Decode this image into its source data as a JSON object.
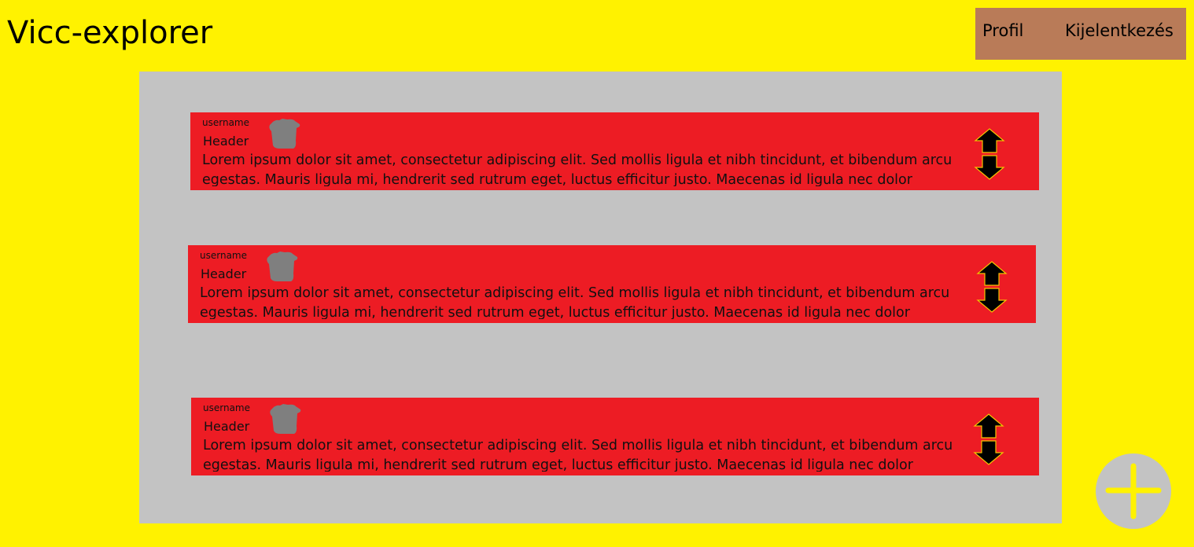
{
  "app": {
    "title": "Vicc-explorer"
  },
  "nav": {
    "profile_label": "Profil",
    "logout_label": "Kijelentkezés"
  },
  "jokes": [
    {
      "username": "username",
      "header": "Header",
      "text": "Lorem ipsum dolor sit amet, consectetur adipiscing elit. Sed mollis ligula et nibh tincidunt, et bibendum arcu egestas. Mauris ligula mi, hendrerit sed rutrum eget, luctus efficitur justo. Maecenas id ligula nec dolor viverra"
    },
    {
      "username": "username",
      "header": "Header",
      "text": "Lorem ipsum dolor sit amet, consectetur adipiscing elit. Sed mollis ligula et nibh tincidunt, et bibendum arcu egestas. Mauris ligula mi, hendrerit sed rutrum eget, luctus efficitur justo. Maecenas id ligula nec dolor viverra"
    },
    {
      "username": "username",
      "header": "Header",
      "text": "Lorem ipsum dolor sit amet, consectetur adipiscing elit. Sed mollis ligula et nibh tincidunt, et bibendum arcu egestas. Mauris ligula mi, hendrerit sed rutrum eget, luctus efficitur justo. Maecenas id ligula nec dolor viverra"
    }
  ],
  "icons": {
    "delete": "trash-icon",
    "upvote": "arrow-up-icon",
    "downvote": "arrow-down-icon",
    "add": "plus-icon"
  },
  "colors": {
    "page_background": "#fff200",
    "nav_background": "#b97b58",
    "feed_background": "#c3c3c3",
    "card_background": "#ed1c24",
    "trash_icon": "#7f7f7f",
    "arrow_fill": "#000000",
    "arrow_outline": "#f5c400",
    "add_button_background": "#c3c3c3",
    "add_button_plus": "#fff200"
  }
}
